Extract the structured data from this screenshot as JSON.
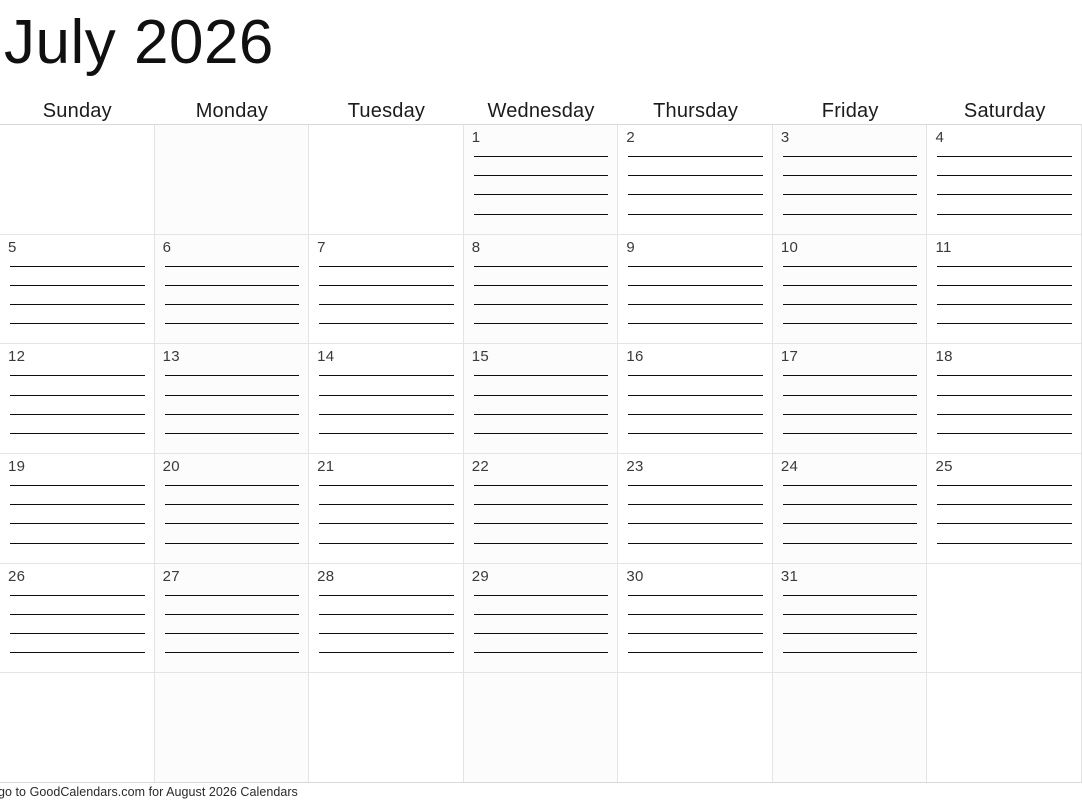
{
  "header": {
    "month_year": "July 2026"
  },
  "weekdays": [
    "Sunday",
    "Monday",
    "Tuesday",
    "Wednesday",
    "Thursday",
    "Friday",
    "Saturday"
  ],
  "grid": {
    "lines_per_day": 4,
    "weeks": [
      [
        "",
        "",
        "",
        "1",
        "2",
        "3",
        "4"
      ],
      [
        "5",
        "6",
        "7",
        "8",
        "9",
        "10",
        "11"
      ],
      [
        "12",
        "13",
        "14",
        "15",
        "16",
        "17",
        "18"
      ],
      [
        "19",
        "20",
        "21",
        "22",
        "23",
        "24",
        "25"
      ],
      [
        "26",
        "27",
        "28",
        "29",
        "30",
        "31",
        ""
      ],
      [
        "",
        "",
        "",
        "",
        "",
        "",
        ""
      ]
    ]
  },
  "footer": {
    "text": "go to GoodCalendars.com for August 2026 Calendars"
  },
  "colors": {
    "page_background": "#ffffff",
    "title_text": "#101010",
    "grid_line": "#e4e4e4",
    "write_line": "#0d0d0d",
    "day_number": "#3a3a3a",
    "footer_text": "#2a2a2a"
  }
}
